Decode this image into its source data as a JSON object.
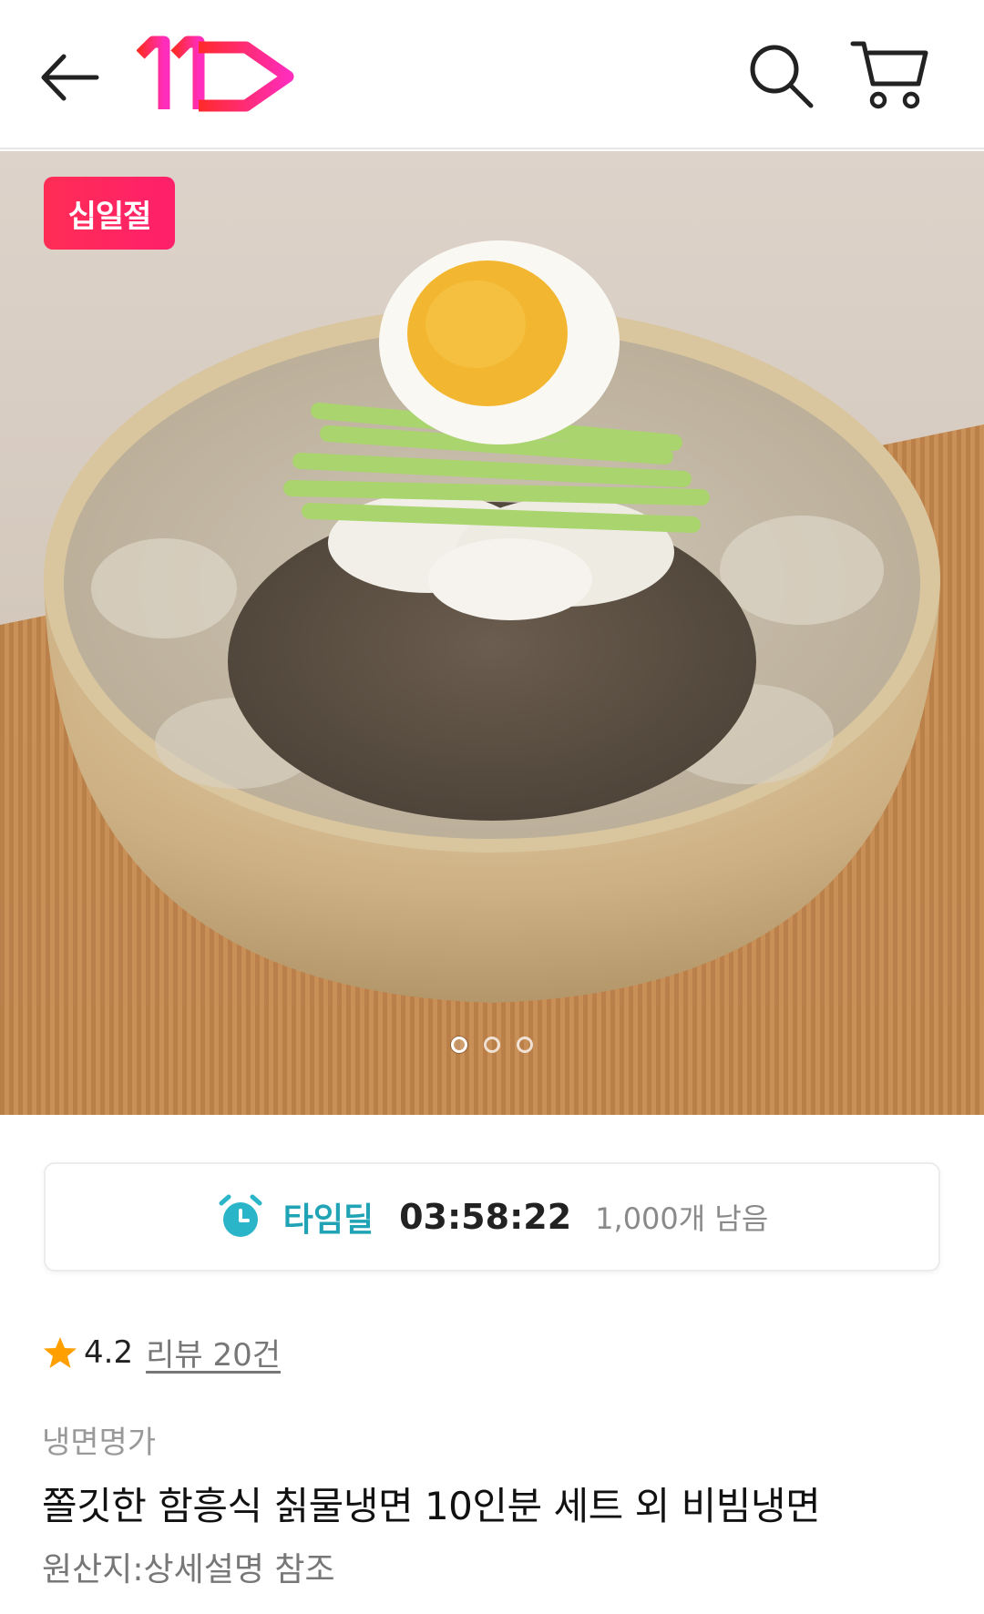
{
  "header": {
    "back_icon": "arrow-left-icon",
    "logo_text": "11",
    "search_icon": "search-icon",
    "cart_icon": "cart-icon",
    "colors": {
      "logo_gradient_start": "#ff2a2a",
      "logo_gradient_end": "#ff2dbb"
    }
  },
  "hero": {
    "badge_label": "십일절",
    "badge_color": "#ff2d55",
    "image_icon": "naengmyeon-photo",
    "pager": {
      "total": 3,
      "active_index": 0
    }
  },
  "timedeal": {
    "icon": "alarm-clock-icon",
    "label": "타임딜",
    "timer": "03:58:22",
    "stock": "1,000개 남음",
    "accent_color": "#1fa3b5"
  },
  "rating": {
    "icon": "star-icon",
    "score": "4.2",
    "reviews_label": "리뷰 20건",
    "star_color": "#ff9f00"
  },
  "product": {
    "seller": "냉면명가",
    "title": "쫄깃한 함흥식 칡물냉면 10인분 세트 외 비빔냉면",
    "origin": "원산지:상세설명 참조"
  }
}
